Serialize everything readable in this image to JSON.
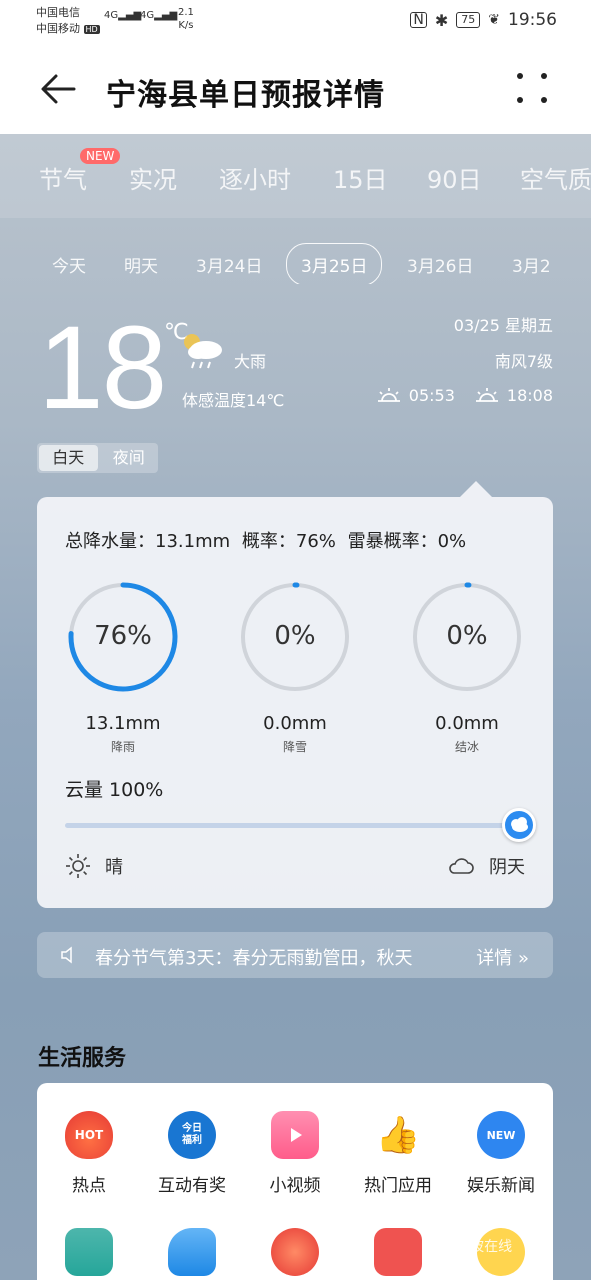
{
  "status_bar": {
    "carrier1": "中国电信",
    "carrier2": "中国移动",
    "hd_badge": "HD",
    "signal1": "4G",
    "signal2": "4G",
    "speed_value": "2.1",
    "speed_unit": "K/s",
    "battery": "75",
    "time": "19:56"
  },
  "header": {
    "title": "宁海县单日预报详情"
  },
  "tabs": {
    "items": [
      "节气",
      "实况",
      "逐小时",
      "15日",
      "90日",
      "空气质"
    ],
    "new_badge": "NEW"
  },
  "days": {
    "items": [
      "今天",
      "明天",
      "3月24日",
      "3月25日",
      "3月26日",
      "3月2"
    ],
    "active_index": 3
  },
  "current": {
    "temperature": "18",
    "degree_unit": "℃",
    "weather": "大雨",
    "feels_like": "体感温度14℃",
    "date": "03/25 星期五",
    "wind": "南风7级",
    "sunrise": "05:53",
    "sunset": "18:08"
  },
  "day_night": {
    "day": "白天",
    "night": "夜间",
    "active": "day"
  },
  "precip_card": {
    "summary": "总降水量：13.1mm  概率：76%  雷暴概率：0%",
    "gauges": [
      {
        "pct_label": "76%",
        "pct": 76,
        "amount": "13.1mm",
        "label": "降雨"
      },
      {
        "pct_label": "0%",
        "pct": 0,
        "amount": "0.0mm",
        "label": "降雪"
      },
      {
        "pct_label": "0%",
        "pct": 0,
        "amount": "0.0mm",
        "label": "结冰"
      }
    ],
    "cloud_label": "云量 100%",
    "cloud_level": 100,
    "sunny_label": "晴",
    "cloudy_label": "阴天"
  },
  "ticker": {
    "text": "春分节气第3天：春分无雨勤管田，秋天",
    "more": "详情 »"
  },
  "services": {
    "title": "生活服务",
    "items": [
      {
        "label": "热点",
        "icon": "hot-icon",
        "icon_text": "HOT"
      },
      {
        "label": "互动有奖",
        "icon": "today-welfare-icon",
        "icon_text": "今日福利"
      },
      {
        "label": "小视频",
        "icon": "video-play-icon"
      },
      {
        "label": "热门应用",
        "icon": "thumbs-up-icon"
      },
      {
        "label": "娱乐新闻",
        "icon": "news-icon",
        "icon_text": "NEW"
      }
    ]
  },
  "colors": {
    "accent_blue": "#1e88e5",
    "ring_gray": "#d0d4da",
    "hot_red": "#f4511e"
  },
  "watermark": "宁波在线"
}
